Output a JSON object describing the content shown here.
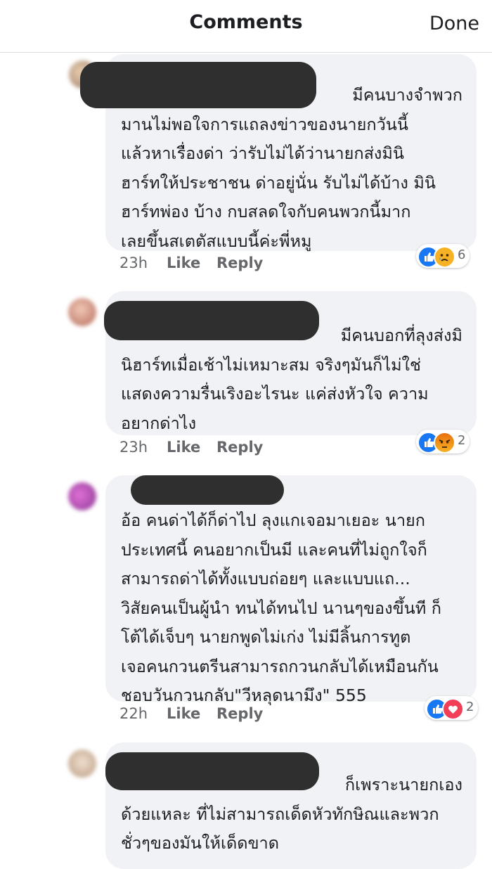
{
  "header": {
    "title": "Comments",
    "done_label": "Done"
  },
  "comments": [
    {
      "text": "มีคนบางจำพวก\nมานไม่พอใจการแถลงข่าวของนายกวันนี้\nแล้วหาเรื่องด่า ว่ารับไม่ได้ว่านายกส่งมินิ\nฮาร์ทให้ประชาชน ด่าอยู่นั่น รับไม่ได้บ้าง มินิ\nฮาร์ทพ่อง บ้าง กบสลดใจกับคนพวกนี้มาก\nเลยขึ้นสเตตัสแบบนี้ค่ะพี่หมู",
      "time": "23h",
      "like_label": "Like",
      "reply_label": "Reply",
      "reactions": [
        "like",
        "sad"
      ],
      "reaction_count": "6",
      "avatar_color": "#c9a98a"
    },
    {
      "text": "มีคนบอกที่ลุงส่งมิ\nนิฮาร์ทเมื่อเช้าไม่เหมาะสม จริงๆมันก็ไม่ใช่\nแสดงความรื่นเริงอะไรนะ แค่ส่งหัวใจ ความ\nอยากด่าไง",
      "time": "23h",
      "like_label": "Like",
      "reply_label": "Reply",
      "reactions": [
        "like",
        "angry"
      ],
      "reaction_count": "2",
      "avatar_color": "#d99c8a"
    },
    {
      "text": "อ้อ คนด่าได้ก็ด่าไป ลุงแกเจอมาเยอะ นายก\nประเทศนี้ คนอยากเป็นมี และคนที่ไม่ถูกใจก็\nสามารถด่าได้ทั้งแบบถ่อยๆ และแบบแถ...\nวิสัยคนเป็นผู้นำ ทนได้ทนไป นานๆของขึ้นที ก็\nโต้ได้เจ็บๆ นายกพูดไม่เก่ง ไม่มีลิ้นการทูต\nเจอคนกวนตรีนสามารถกวนกลับได้เหมือนกัน\nชอบวันกวนกลับ\"วีหลุดนามึง\" 555",
      "time": "22h",
      "like_label": "Like",
      "reply_label": "Reply",
      "reactions": [
        "like",
        "love"
      ],
      "reaction_count": "2",
      "avatar_color": "#b85ab0"
    },
    {
      "text": "ก็เพราะนายกเอง\nด้วยแหละ ที่ไม่สามารถเด็ดหัวทักษิณและพวก\nชั่วๆของมันให้เด็ดขาด",
      "avatar_color": "#d8c4b0"
    }
  ]
}
